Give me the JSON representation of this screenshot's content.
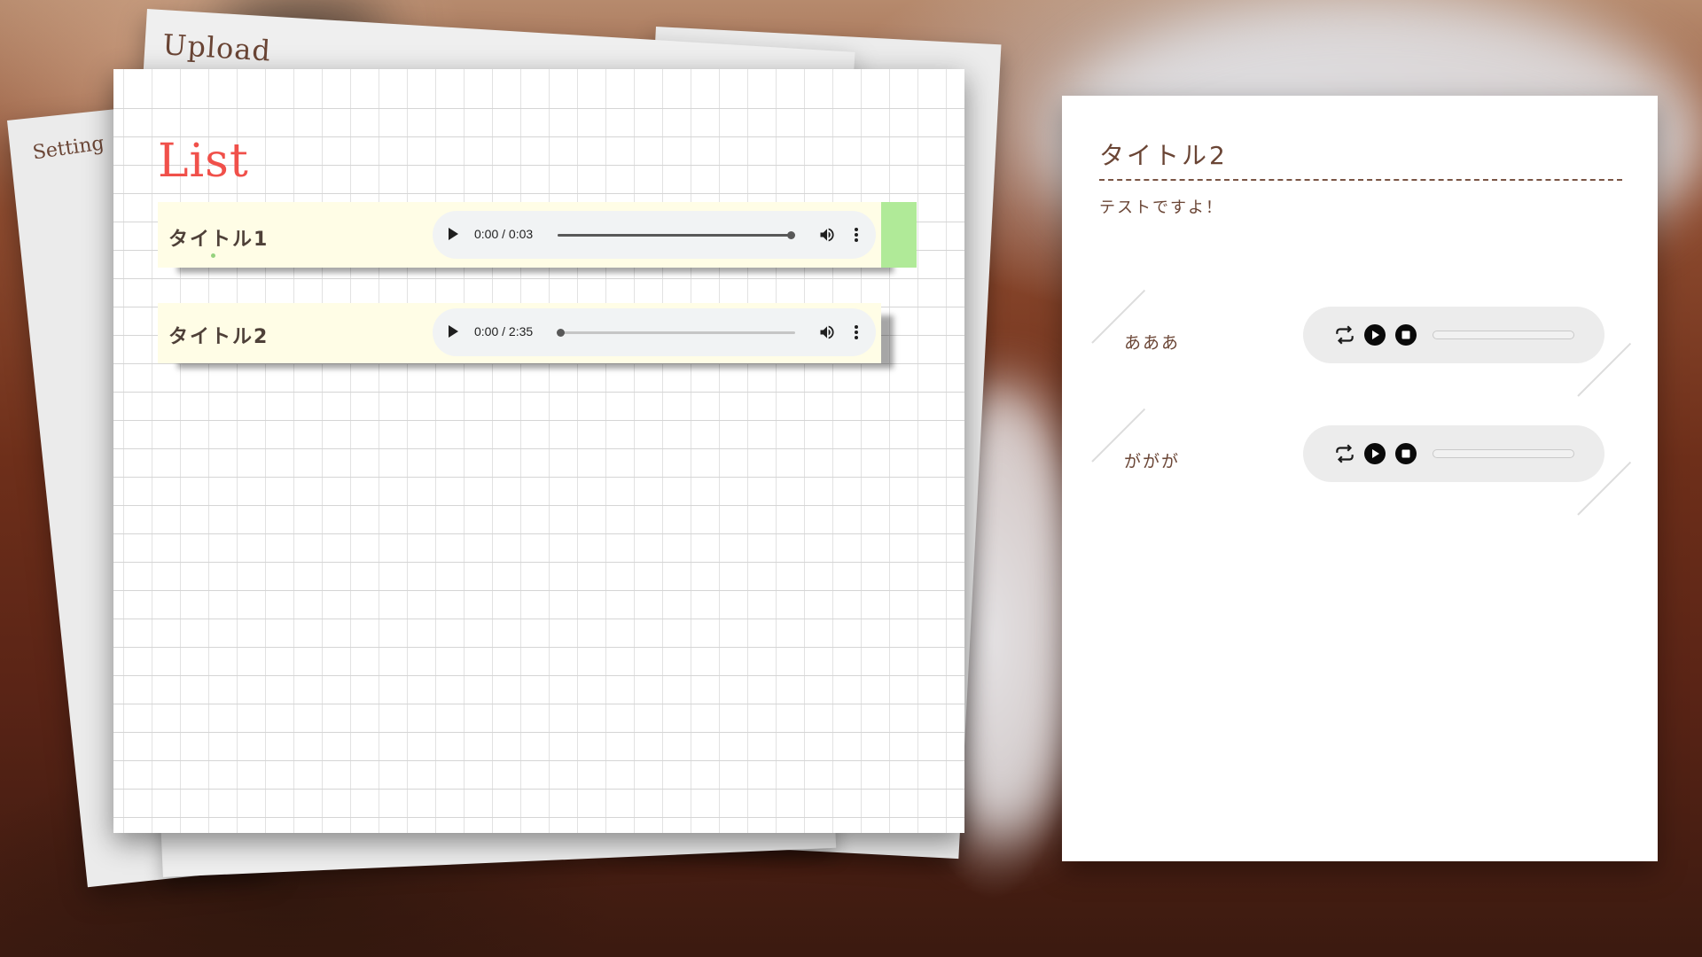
{
  "tabs": {
    "upload_label": "Upload",
    "setting_label": "Setting"
  },
  "list": {
    "title": "List",
    "items": [
      {
        "title": "タイトル1",
        "selected": true,
        "player": {
          "time": "0:00 / 0:03",
          "progress": 0.98
        }
      },
      {
        "title": "タイトル2",
        "selected": false,
        "player": {
          "time": "0:00 / 2:35",
          "progress": 0.01
        }
      }
    ]
  },
  "detail": {
    "title": "タイトル2",
    "description": "テストですよ！",
    "tracks": [
      {
        "name": "あああ",
        "progress": 0
      },
      {
        "name": "ががが",
        "progress": 0
      }
    ]
  },
  "icons": {
    "player_play": "play-icon",
    "player_volume": "volume-icon",
    "player_more": "more-vert-icon",
    "track_loop": "loop-icon",
    "track_play": "play-circle-icon",
    "track_stop": "stop-circle-icon"
  },
  "colors": {
    "list_title": "#f0504a",
    "row_background": "#fffde6",
    "selected_tab": "#b0ea98",
    "brown_text": "#6a4535"
  }
}
